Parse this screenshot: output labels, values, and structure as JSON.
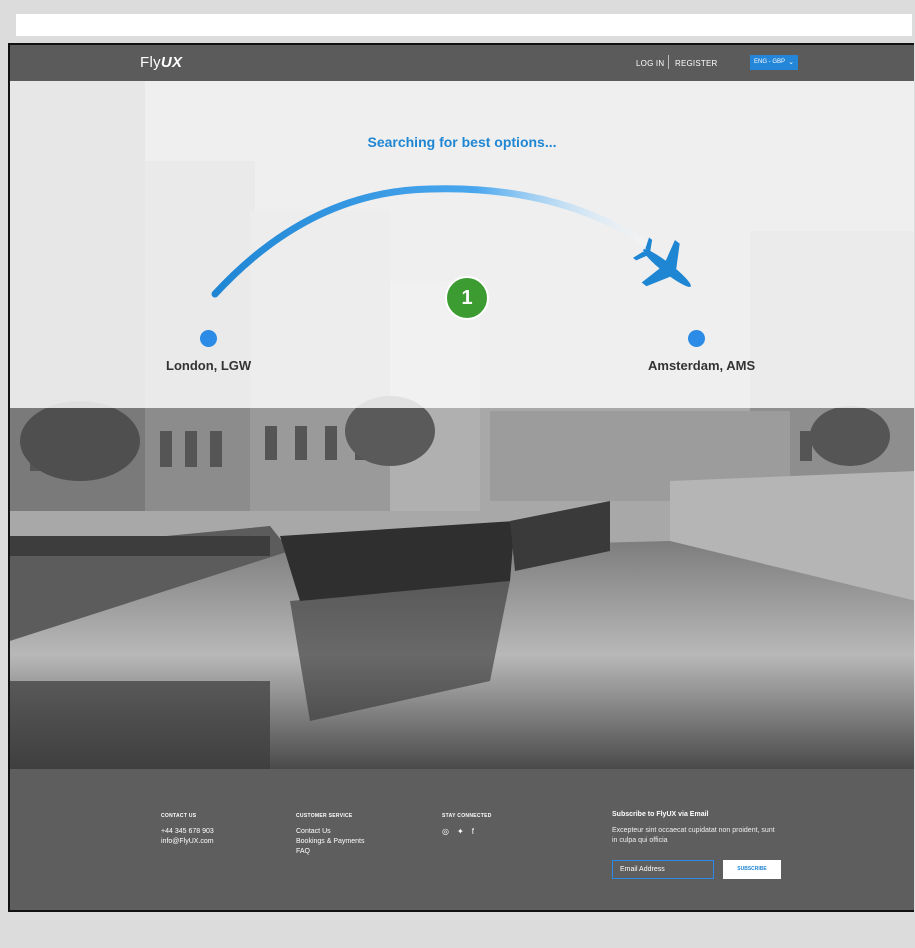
{
  "brand": {
    "logo_prefix": "Fly",
    "logo_suffix": "UX"
  },
  "nav": {
    "login": "LOG IN",
    "register": "REGISTER",
    "language": "ENG - GBP"
  },
  "search": {
    "title": "Searching for best options...",
    "origin": "London, LGW",
    "destination": "Amsterdam, AMS",
    "step_badge": "1"
  },
  "footer": {
    "contact": {
      "heading": "CONTACT US",
      "phone": "+44 345 678 903",
      "email": "info@FlyUX.com"
    },
    "service": {
      "heading": "CUSTOMER SERVICE",
      "items": [
        "Contact Us",
        "Bookings & Payments",
        "FAQ"
      ]
    },
    "social": {
      "heading": "STAY CONNECTED",
      "icons": [
        "instagram-icon",
        "twitter-icon",
        "facebook-icon"
      ]
    },
    "subscribe": {
      "heading": "Subscribe to FlyUX via Email",
      "text": "Excepteur sint occaecat cupidatat non proident, sunt in culpa qui officia",
      "placeholder": "Email Address",
      "button": "SUBSCRIBE"
    }
  },
  "colors": {
    "accent": "#1f86d4",
    "badge": "#3c9b31",
    "nav_bg": "#5b5b5b"
  }
}
